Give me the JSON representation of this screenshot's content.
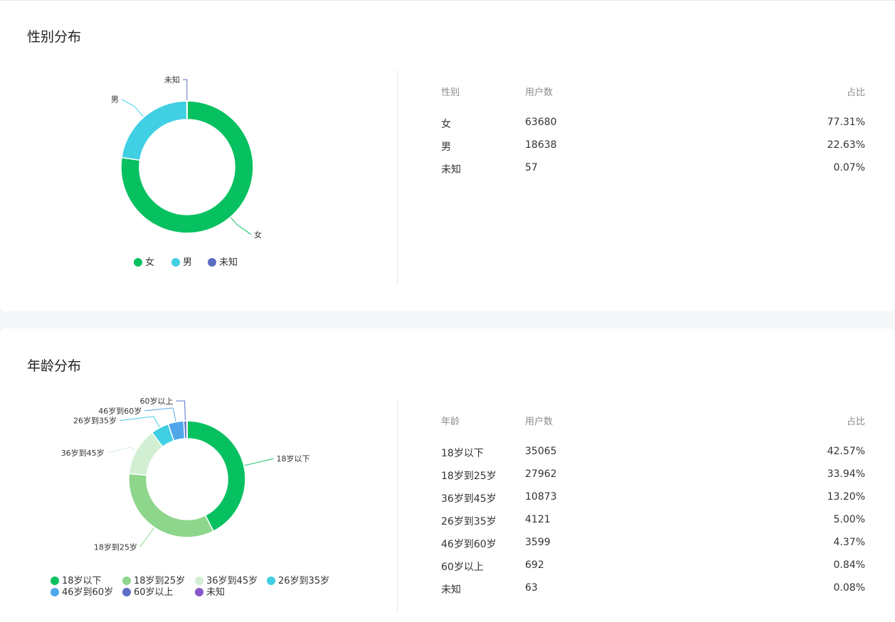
{
  "gender_section": {
    "title": "性别分布",
    "table_headers": {
      "col1": "性别",
      "col2": "用户数",
      "col3": "占比"
    },
    "rows": [
      {
        "name": "女",
        "count": "63680",
        "pct": "77.31%"
      },
      {
        "name": "男",
        "count": "18638",
        "pct": "22.63%"
      },
      {
        "name": "未知",
        "count": "57",
        "pct": "0.07%"
      }
    ]
  },
  "age_section": {
    "title": "年龄分布",
    "table_headers": {
      "col1": "年龄",
      "col2": "用户数",
      "col3": "占比"
    },
    "rows": [
      {
        "name": "18岁以下",
        "count": "35065",
        "pct": "42.57%"
      },
      {
        "name": "18岁到25岁",
        "count": "27962",
        "pct": "33.94%"
      },
      {
        "name": "36岁到45岁",
        "count": "10873",
        "pct": "13.20%"
      },
      {
        "name": "26岁到35岁",
        "count": "4121",
        "pct": "5.00%"
      },
      {
        "name": "46岁到60岁",
        "count": "3599",
        "pct": "4.37%"
      },
      {
        "name": "60岁以上",
        "count": "692",
        "pct": "0.84%"
      },
      {
        "name": "未知",
        "count": "63",
        "pct": "0.08%"
      }
    ]
  },
  "chart_data": [
    {
      "type": "pie",
      "title": "性别分布",
      "categories": [
        "女",
        "男",
        "未知"
      ],
      "values": [
        63680,
        18638,
        57
      ],
      "colors": [
        "#07c160",
        "#40cfe3",
        "#5b6ec6"
      ],
      "legend": [
        "女",
        "男",
        "未知"
      ],
      "legend_position": "bottom"
    },
    {
      "type": "pie",
      "title": "年龄分布",
      "categories": [
        "18岁以下",
        "18岁到25岁",
        "36岁到45岁",
        "26岁到35岁",
        "46岁到60岁",
        "60岁以上",
        "未知"
      ],
      "values": [
        35065,
        27962,
        10873,
        4121,
        3599,
        692,
        63
      ],
      "colors": [
        "#07c160",
        "#8ed68c",
        "#d2efd3",
        "#40cfe3",
        "#4fa7ea",
        "#5a6fc8",
        "#8a56cc"
      ],
      "legend": [
        "18岁以下",
        "18岁到25岁",
        "36岁到45岁",
        "26岁到35岁",
        "46岁到60岁",
        "60岁以上",
        "未知"
      ],
      "legend_position": "bottom"
    }
  ]
}
